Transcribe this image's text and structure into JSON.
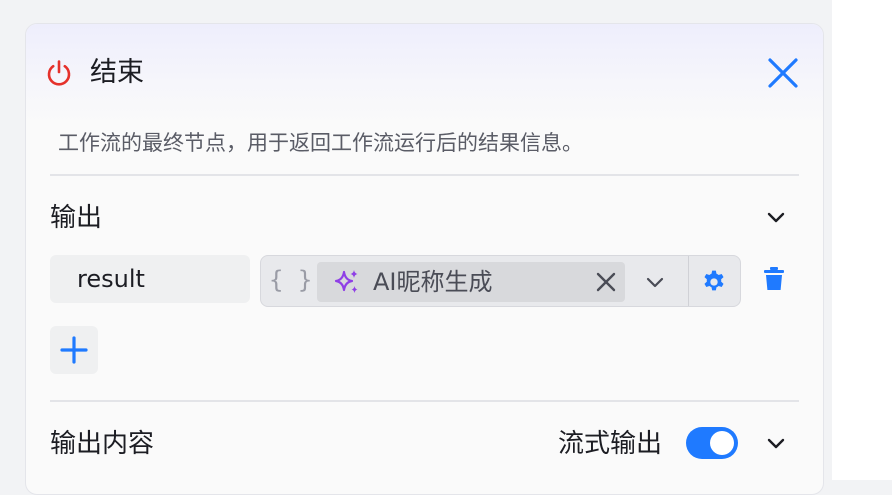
{
  "node": {
    "title": "结束",
    "description": "工作流的最终节点，用于返回工作流运行后的结果信息。"
  },
  "output": {
    "section_title": "输出",
    "variables": [
      {
        "name": "result",
        "type_icon": "{ }",
        "reference": "AI昵称生成"
      }
    ]
  },
  "output_content": {
    "section_title": "输出内容",
    "stream_label": "流式输出",
    "stream_enabled": true
  },
  "icons": {
    "node": "power-icon",
    "close": "close-icon",
    "collapse": "chevron-down-icon",
    "reference": "sparkle-icon",
    "settings": "gear-icon",
    "delete": "trash-icon",
    "add": "plus-icon"
  },
  "colors": {
    "power": "#e5312b",
    "accent": "#1f7aff",
    "sparkle": "#8f3fe6"
  }
}
